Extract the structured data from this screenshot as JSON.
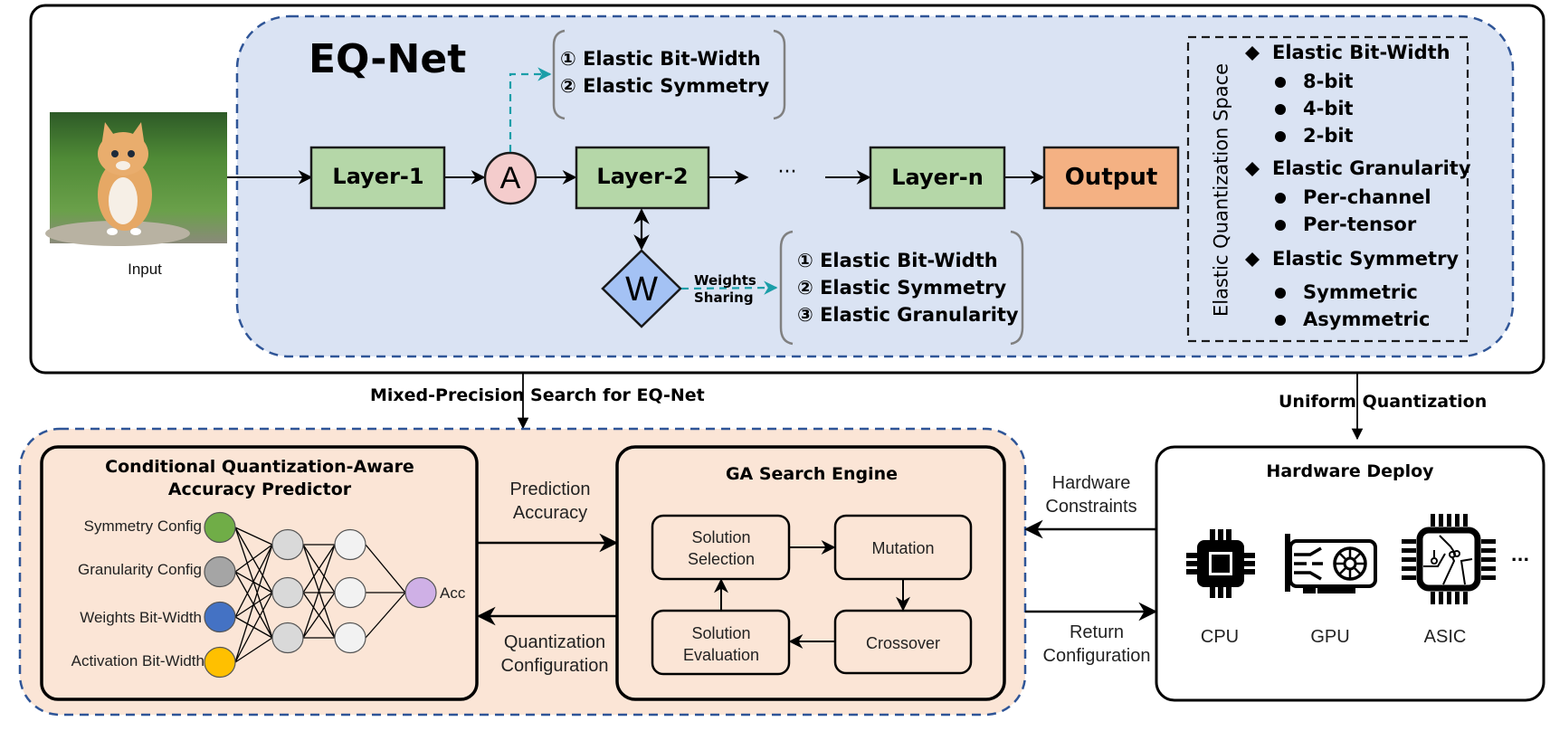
{
  "top_panel": {
    "title": "EQ-Net",
    "input_label": "Input",
    "input_image": "kitten-photo",
    "layers": [
      "Layer-1",
      "Layer-2",
      "Layer-n"
    ],
    "ellipsis": "···",
    "output_label": "Output",
    "activation_node": "A",
    "weights_node": "W",
    "weights_sharing_label": [
      "Weights",
      "Sharing"
    ],
    "activation_options": [
      "① Elastic Bit-Width",
      "② Elastic Symmetry"
    ],
    "weight_options": [
      "① Elastic Bit-Width",
      "② Elastic Symmetry",
      "③ Elastic Granularity"
    ],
    "space": {
      "title": "Elastic Quantization Space",
      "groups": [
        {
          "name": "Elastic Bit-Width",
          "items": [
            "8-bit",
            "4-bit",
            "2-bit"
          ]
        },
        {
          "name": "Elastic Granularity",
          "items": [
            "Per-channel",
            "Per-tensor"
          ]
        },
        {
          "name": "Elastic Symmetry",
          "items": [
            "Symmetric",
            "Asymmetric"
          ]
        }
      ]
    }
  },
  "connectors": {
    "mixed_precision": "Mixed-Precision Search for EQ-Net",
    "uniform_quantization": "Uniform Quantization",
    "prediction_accuracy": [
      "Prediction",
      "Accuracy"
    ],
    "quantization_configuration": [
      "Quantization",
      "Configuration"
    ],
    "hardware_constraints": [
      "Hardware",
      "Constraints"
    ],
    "return_configuration": [
      "Return",
      "Configuration"
    ]
  },
  "predictor": {
    "title": [
      "Conditional Quantization-Aware",
      "Accuracy Predictor"
    ],
    "inputs": [
      {
        "label": "Symmetry Config",
        "color": "#70ad47"
      },
      {
        "label": "Granularity Config",
        "color": "#a5a5a5"
      },
      {
        "label": "Weights Bit-Width",
        "color": "#4472c4"
      },
      {
        "label": "Activation Bit-Width",
        "color": "#ffc000"
      }
    ],
    "hidden1_color": "#d9d9d9",
    "hidden2_color": "#f2f2f2",
    "output": {
      "label": "Acc",
      "color": "#cfb0e6"
    }
  },
  "ga_engine": {
    "title": "GA Search Engine",
    "steps": {
      "selection": [
        "Solution",
        "Selection"
      ],
      "mutation": [
        "Mutation"
      ],
      "crossover": [
        "Crossover"
      ],
      "evaluation": [
        "Solution",
        "Evaluation"
      ]
    }
  },
  "hardware": {
    "title": "Hardware Deploy",
    "devices": [
      {
        "label": "CPU",
        "icon": "cpu-chip-icon"
      },
      {
        "label": "GPU",
        "icon": "graphics-card-icon"
      },
      {
        "label": "ASIC",
        "icon": "asic-chip-icon"
      }
    ],
    "more": "..."
  },
  "colors": {
    "eqnet_bg": "#dae3f3",
    "search_bg": "#fbe5d6",
    "layer_fill": "#b5d7a8",
    "output_fill": "#f4b183",
    "activation_fill": "#f4cccc",
    "weights_fill": "#a4c2f4",
    "dashed_border": "#2f5597",
    "teal_link": "#1a9ea8"
  }
}
